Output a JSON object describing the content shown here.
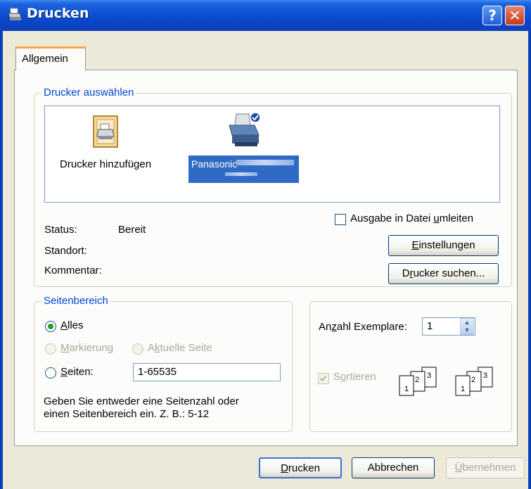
{
  "window": {
    "title": "Drucken",
    "help_label": "?",
    "close_label": "✕",
    "icon": "printer-icon"
  },
  "tabs": [
    {
      "label": "Allgemein",
      "active": true
    }
  ],
  "select_printer": {
    "legend": "Drucker auswählen",
    "items": [
      {
        "label": "Drucker hinzufügen",
        "icon": "add-printer-icon"
      },
      {
        "label": "Panasonic",
        "icon": "printer-icon",
        "selected": true
      }
    ],
    "status_label": "Status:",
    "status_value": "Bereit",
    "location_label": "Standort:",
    "comment_label": "Kommentar:",
    "print_to_file": {
      "pre": "Ausgabe in Datei ",
      "accel": "u",
      "post": "mleiten",
      "checked": false
    },
    "preferences": {
      "pre": "",
      "accel": "E",
      "post": "instellungen"
    },
    "find_printer": {
      "pre": "D",
      "accel": "r",
      "post": "ucker suchen..."
    }
  },
  "page_range": {
    "legend": "Seitenbereich",
    "all": {
      "pre": "",
      "accel": "A",
      "post": "lles",
      "checked": true
    },
    "selection": {
      "pre": "",
      "accel": "M",
      "post": "arkierung",
      "disabled": true
    },
    "current_page": {
      "pre": "A",
      "accel": "k",
      "post": "tuelle Seite",
      "disabled": true
    },
    "pages": {
      "pre": "",
      "accel": "S",
      "post": "eiten:",
      "value": "1-65535"
    },
    "hint_line1": "Geben Sie entweder eine Seitenzahl oder",
    "hint_line2": "einen Seitenbereich ein. Z. B.: 5-12"
  },
  "copies": {
    "label": {
      "pre": "An",
      "accel": "z",
      "post": "ahl Exemplare:"
    },
    "value": "1",
    "collate": {
      "pre": "S",
      "accel": "o",
      "post": "rtieren",
      "checked": true,
      "disabled": true
    },
    "collate_pages": [
      "1",
      "2",
      "3"
    ]
  },
  "footer": {
    "print": {
      "pre": "",
      "accel": "D",
      "post": "rucken"
    },
    "cancel": "Abbrechen",
    "apply": {
      "pre": "",
      "accel": "Ü",
      "post": "bernehmen"
    }
  }
}
